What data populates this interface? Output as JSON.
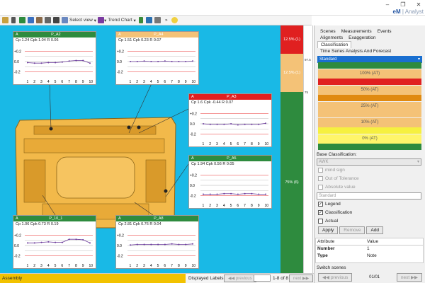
{
  "app": {
    "title_prefix": "eM",
    "title_rest": "Analyst"
  },
  "window_controls": {
    "minimize": "–",
    "restore": "❐",
    "close": "✕"
  },
  "toolbar": {
    "select_view": "Select view",
    "trend_chart": "Trend Chart"
  },
  "cards": [
    {
      "header_left": "A",
      "header_name": "P_A2",
      "stats": "Cp 1.24  Cpk 1.04  R 0.06",
      "color": "#2e8b3e",
      "yticks": [
        "+0.2",
        "0.0",
        "-0.2"
      ],
      "xticks": [
        "1",
        "2",
        "3",
        "4",
        "5",
        "6",
        "7",
        "8",
        "9",
        "10"
      ],
      "values": [
        -0.02,
        -0.03,
        -0.03,
        -0.02,
        -0.02,
        -0.01,
        0.01,
        0.02,
        0.02,
        -0.03
      ]
    },
    {
      "header_left": "A",
      "header_name": "P_A4",
      "stats": "Cp 1.51  Cpk 0.23  R 0.07",
      "color": "#f4c277",
      "yticks": [
        "+0.2",
        "0.0",
        "-0.2"
      ],
      "xticks": [
        "1",
        "2",
        "3",
        "4",
        "5",
        "6",
        "7",
        "8",
        "9",
        "10"
      ],
      "values": [
        0.0,
        0.0,
        0.01,
        0.0,
        0.0,
        0.01,
        0.0,
        0.0,
        0.0,
        0.01
      ]
    },
    {
      "header_left": "A",
      "header_name": "P_A3",
      "stats": "Cp 1.6  Cpk -0.44  R 0.07",
      "color": "#e02020",
      "yticks": [
        "+0.2",
        "0.0",
        "-0.2"
      ],
      "xticks": [
        "1",
        "2",
        "3",
        "4",
        "5",
        "6",
        "7",
        "8",
        "9",
        "10"
      ],
      "values": [
        0.0,
        -0.01,
        -0.01,
        -0.01,
        0.0,
        -0.02,
        -0.01,
        -0.01,
        -0.01,
        0.01
      ]
    },
    {
      "header_left": "A",
      "header_name": "P_A5",
      "stats": "Cp 1.94  Cpk 0.56  R 0.05",
      "color": "#2e8b3e",
      "yticks": [
        "+0.2",
        "0.0",
        "-0.2"
      ],
      "xticks": [
        "1",
        "2",
        "3",
        "4",
        "5",
        "6",
        "7",
        "8",
        "9",
        "10"
      ],
      "values": [
        -0.17,
        -0.17,
        -0.17,
        -0.16,
        -0.16,
        -0.17,
        -0.16,
        -0.16,
        -0.17,
        -0.17
      ]
    },
    {
      "header_left": "A",
      "header_name": "P_10_1",
      "stats": "Cp 1.06  Cpk 0.73  R 0.19",
      "color": "#2e8b3e",
      "yticks": [
        "+0.2",
        "0.0",
        "-0.2"
      ],
      "xticks": [
        "1",
        "2",
        "3",
        "4",
        "5",
        "6",
        "7",
        "8",
        "9",
        "10"
      ],
      "values": [
        0.05,
        0.05,
        0.06,
        0.07,
        0.06,
        0.06,
        0.12,
        0.12,
        0.11,
        0.05
      ]
    },
    {
      "header_left": "A",
      "header_name": "P_A8",
      "stats": "Cp 2.81  Cpk 0.76  R 0.04",
      "color": "#2e8b3e",
      "yticks": [
        "+0.2",
        "0.0",
        "-0.2"
      ],
      "xticks": [
        "1",
        "2",
        "3",
        "4",
        "5",
        "6",
        "7",
        "8",
        "9",
        "10"
      ],
      "values": [
        0.01,
        0.02,
        0.02,
        0.02,
        0.02,
        0.02,
        0.03,
        0.02,
        0.02,
        0.03
      ]
    }
  ],
  "color_bar": {
    "seg_red": "12.5% (1)",
    "seg_orange": "12.5% (1)",
    "seg_green": "75% (6)",
    "scale_top": "97.5",
    "scale_mid": "75"
  },
  "right_panel": {
    "tabs": [
      "Scenes",
      "Measurements",
      "Events",
      "Alignments",
      "Exaggeration"
    ],
    "tabs2": [
      "Classification",
      "Time Series Analysis And Forecast"
    ],
    "active_tab": "Classification",
    "standard": "Standard",
    "legend_labels": [
      "100% (AT)",
      "50% (AT)",
      "25% (AT)",
      "10% (AT)",
      "0% (AT)"
    ],
    "base_class_label": "Base Classification:",
    "base_class_value": "AWK",
    "mind_sign": "mind sign",
    "out_of_tol": "Out of Tolerance",
    "abs_value": "Absolute value",
    "standard2": "Standard",
    "chk_legend": "Legend",
    "chk_class": "Classification",
    "chk_actual": "Actual",
    "btn_apply": "Apply",
    "btn_remove": "Remove",
    "btn_add": "Add",
    "attr_h": "Attribute",
    "val_h": "Value",
    "attr_rows": [
      {
        "a": "Number",
        "v": "1"
      },
      {
        "a": "Type",
        "v": "Note"
      }
    ],
    "switch_scenes": "Switch scenes",
    "prev": "previous",
    "next": "next",
    "scene_count": "01/01"
  },
  "status": {
    "label": "Assembly",
    "displayed": "Displayed Labels",
    "prev": "previous",
    "range": "1-8 of 8",
    "next": "next"
  }
}
